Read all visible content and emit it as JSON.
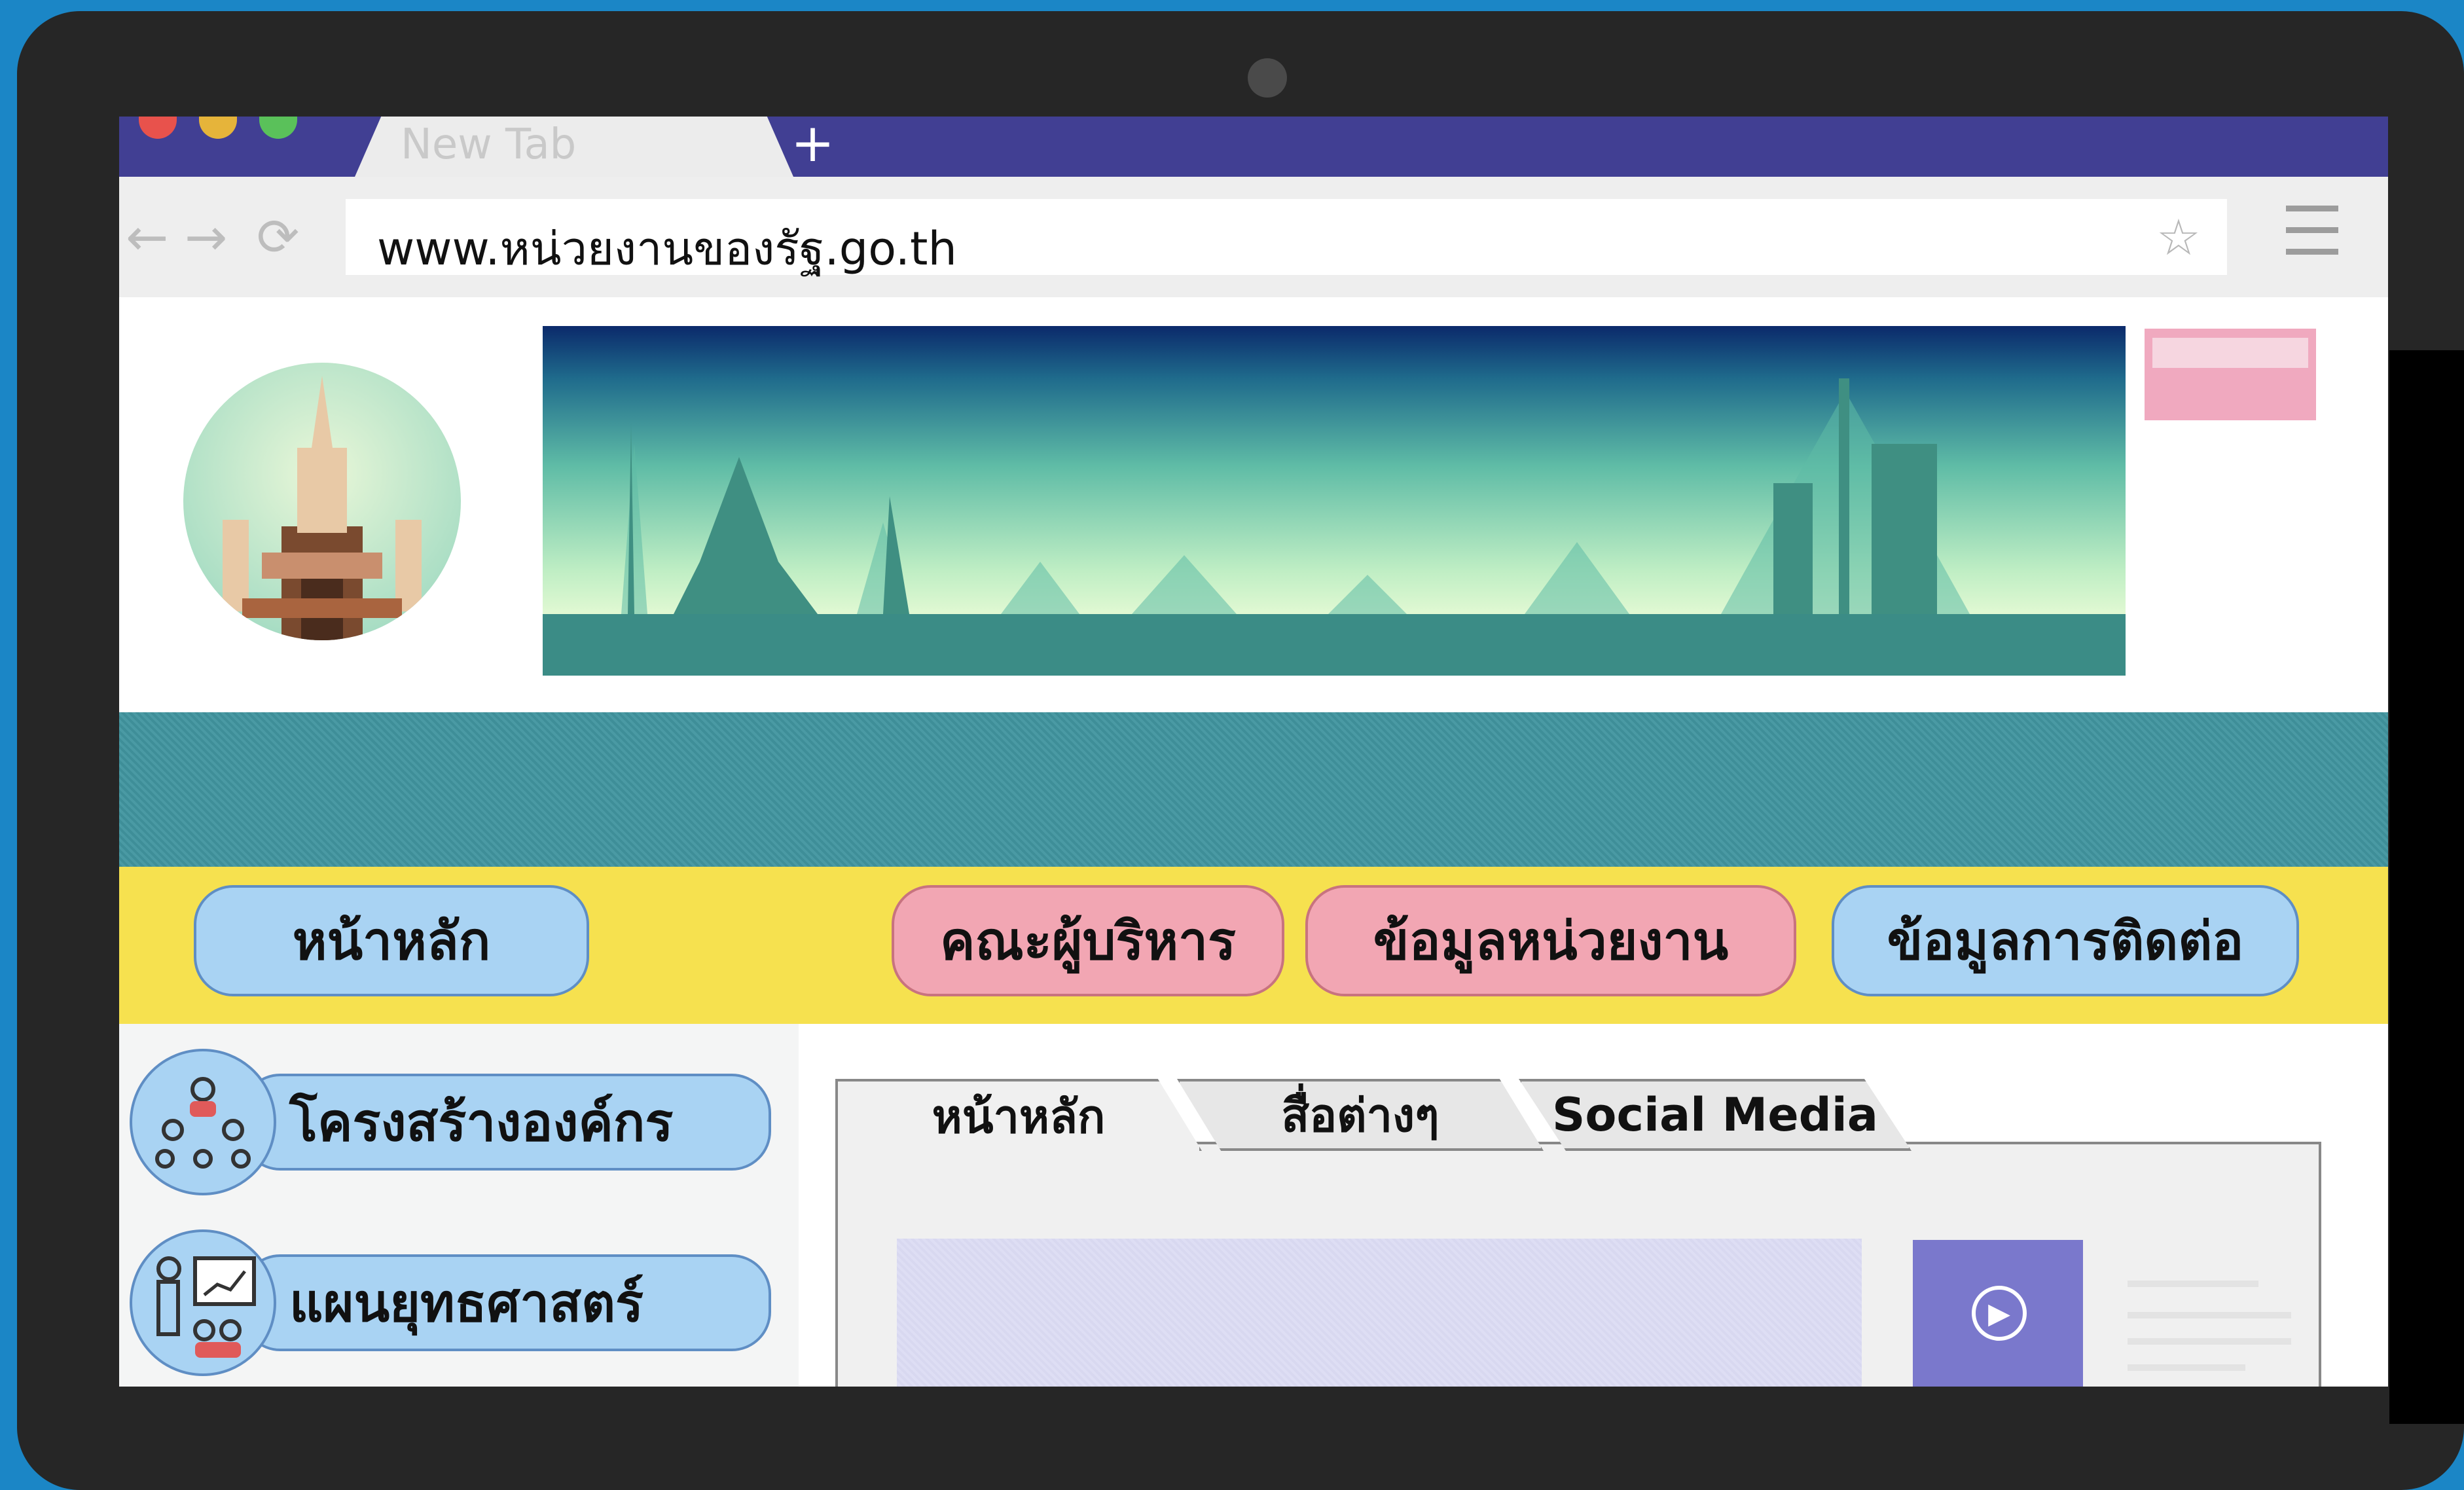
{
  "browser": {
    "tab_title": "New Tab",
    "new_tab_symbol": "+",
    "url": "www.หน่วยงานของรัฐ.go.th",
    "back_symbol": "←",
    "forward_symbol": "→",
    "reload_symbol": "⟳",
    "bookmark_symbol": "☆"
  },
  "nav": {
    "home": "หน้าหลัก",
    "executives": "คณะผู้บริหาร",
    "agency_info": "ข้อมูลหน่วยงาน",
    "contact": "ข้อมูลการติดต่อ"
  },
  "sidebar": {
    "items": [
      {
        "label": "โครงสร้างองค์กร",
        "icon": "org-chart-icon"
      },
      {
        "label": "แผนยุทธศาสตร์",
        "icon": "presentation-icon"
      }
    ]
  },
  "content_tabs": {
    "home": "หน้าหลัก",
    "media": "สื่อต่างๆ",
    "social": "Social Media"
  },
  "colors": {
    "background": "#1b86c6",
    "tabbar": "#413f93",
    "teal_band": "#4a9aa4",
    "nav_band": "#f6e14f",
    "pill_blue": "#a9d3f3",
    "pill_pink": "#f2a6b3"
  }
}
